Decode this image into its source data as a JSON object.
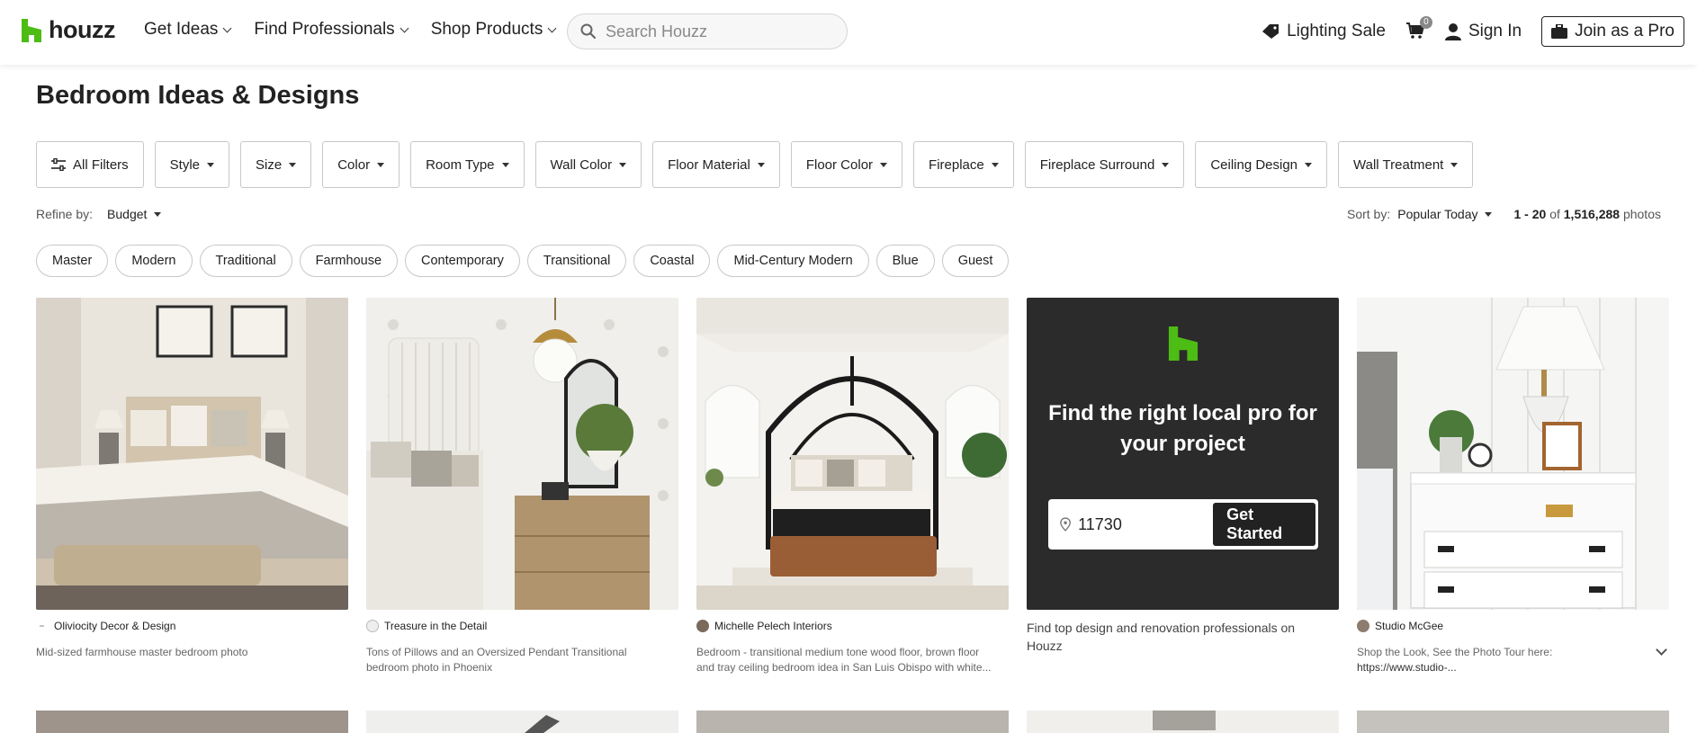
{
  "header": {
    "logo_text": "houzz",
    "nav": [
      {
        "label": "Get Ideas"
      },
      {
        "label": "Find Professionals"
      },
      {
        "label": "Shop Products"
      }
    ],
    "search_placeholder": "Search Houzz",
    "lighting_sale": "Lighting Sale",
    "cart_count": "0",
    "sign_in": "Sign In",
    "join_pro": "Join as a Pro"
  },
  "page_title": "Bedroom Ideas & Designs",
  "filters": {
    "all_filters": "All Filters",
    "items": [
      "Style",
      "Size",
      "Color",
      "Room Type",
      "Wall Color",
      "Floor Material",
      "Floor Color",
      "Fireplace",
      "Fireplace Surround",
      "Ceiling Design",
      "Wall Treatment"
    ]
  },
  "refine": {
    "label": "Refine by:",
    "budget": "Budget"
  },
  "sort": {
    "label": "Sort by:",
    "value": "Popular Today",
    "count_range": "1 - 20",
    "count_of": "of",
    "count_total": "1,516,288",
    "count_unit": "photos"
  },
  "chips": [
    "Master",
    "Modern",
    "Traditional",
    "Farmhouse",
    "Contemporary",
    "Transitional",
    "Coastal",
    "Mid-Century Modern",
    "Blue",
    "Guest"
  ],
  "cards": [
    {
      "author": "Oliviocity Decor & Design",
      "desc": "Mid-sized farmhouse master bedroom photo"
    },
    {
      "author": "Treasure in the Detail",
      "desc": "Tons of Pillows and an Oversized Pendant Transitional bedroom photo in Phoenix"
    },
    {
      "author": "Michelle Pelech Interiors",
      "desc": "Bedroom - transitional medium tone wood floor, brown floor and tray ceiling bedroom idea in San Luis Obispo with white..."
    },
    {
      "author": "Studio McGee",
      "desc": "Shop the Look, See the Photo Tour here:",
      "desc2": "https://www.studio-..."
    }
  ],
  "promo": {
    "title": "Find the right local pro for your project",
    "zip": "11730",
    "button": "Get Started",
    "caption": "Find top design and renovation professionals on Houzz"
  },
  "colors": {
    "brand_green": "#4dbc15",
    "promo_bg": "#2b2b2b"
  }
}
